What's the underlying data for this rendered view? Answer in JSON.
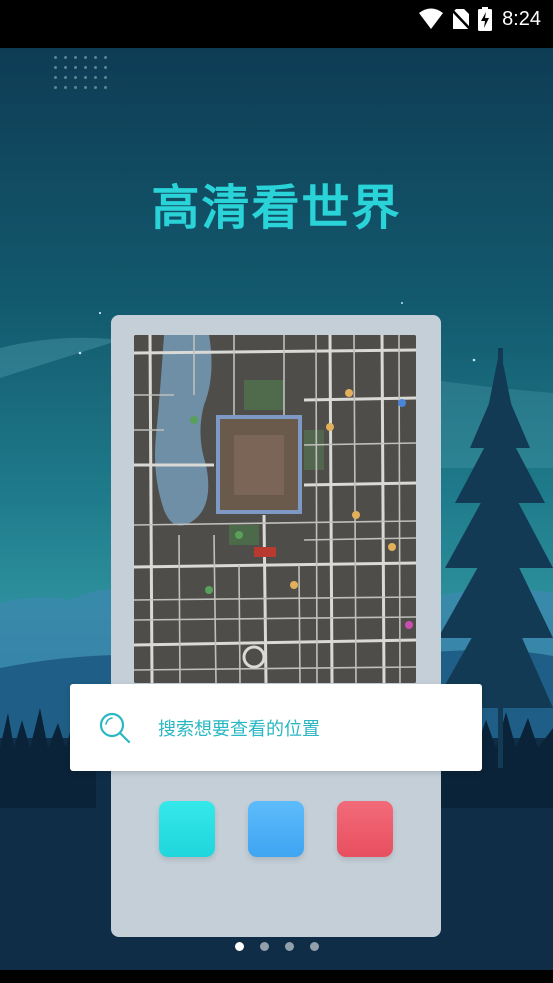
{
  "status_bar": {
    "time": "8:24",
    "icons": [
      "wifi-icon",
      "no-sim-icon",
      "battery-charging-icon"
    ]
  },
  "slide": {
    "headline": "高清看世界",
    "search_placeholder": "搜索想要查看的位置",
    "search_icon": "search-icon",
    "app_tiles": [
      {
        "name": "cyan-app-tile",
        "color": "#27dfe3"
      },
      {
        "name": "blue-app-tile",
        "color": "#4db0f7"
      },
      {
        "name": "red-app-tile",
        "color": "#ee5b6a"
      }
    ]
  },
  "pager": {
    "page_count": 4,
    "active_index": 0
  },
  "colors": {
    "accent": "#2ad3d8",
    "status_bar": "#000000",
    "card": "#c5cfd8"
  }
}
